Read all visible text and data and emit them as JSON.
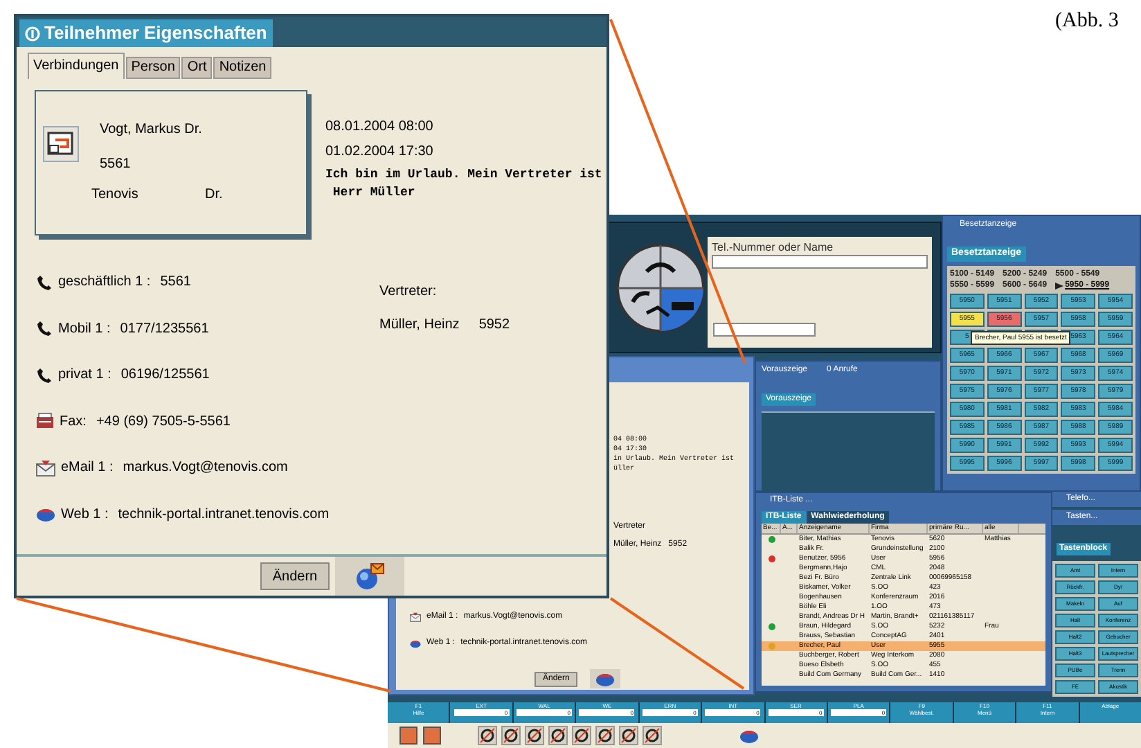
{
  "caption": "(Abb. 3",
  "dialog": {
    "title": "Teilnehmer Eigenschaften",
    "tabs": [
      {
        "label": "Verbindungen",
        "selected": true
      },
      {
        "label": "Person",
        "selected": false
      },
      {
        "label": "Ort",
        "selected": false
      },
      {
        "label": "Notizen",
        "selected": false
      }
    ],
    "card": {
      "name": "Vogt, Markus Dr.",
      "number": "5561",
      "company": "Tenovis",
      "title": "Dr."
    },
    "absence": {
      "from": "08.01.2004 08:00",
      "to": "01.02.2004 17:30",
      "message": [
        "Ich bin im Urlaub. Mein Vertreter ist",
        " Herr Müller"
      ]
    },
    "contacts": [
      {
        "kind": "phone",
        "label": "geschäftlich 1 :",
        "value": "5561"
      },
      {
        "kind": "phone",
        "label": "Mobil 1 :",
        "value": "0177/1235561"
      },
      {
        "kind": "phone",
        "label": "privat 1 :",
        "value": "06196/125561"
      },
      {
        "kind": "fax",
        "label": "Fax:",
        "value": "+49 (69) 7505-5-5561"
      },
      {
        "kind": "email",
        "label": "eMail 1 :",
        "value": "markus.Vogt@tenovis.com"
      },
      {
        "kind": "web",
        "label": "Web 1 :",
        "value": "technik-portal.intranet.tenovis.com"
      }
    ],
    "deputy": {
      "heading": "Vertreter:",
      "name": "Müller, Heinz",
      "number": "5952"
    },
    "button": "Ändern"
  },
  "app": {
    "search": {
      "label": "Tel.-Nummer oder Name"
    },
    "detail_copy": {
      "lines": [
        "04 08:00",
        "04 17:30",
        "in Urlaub. Mein Vertreter ist",
        "üller"
      ],
      "deputy_heading": "Vertreter",
      "deputy": "Müller, Heinz   5952",
      "contacts": [
        {
          "kind": "email",
          "label": "eMail 1 :",
          "value": "markus.Vogt@tenovis.com"
        },
        {
          "kind": "web",
          "label": "Web 1 :",
          "value": "technik-portal.intranet.tenovis.com"
        }
      ],
      "button": "Ändern"
    },
    "busy_panel": {
      "title": "Besetztanzeige",
      "tab": "Besetztanzeige",
      "ranges": [
        {
          "label": "5100 - 5149",
          "selected": false
        },
        {
          "label": "5200 - 5249",
          "selected": false
        },
        {
          "label": "5500 - 5549",
          "selected": false
        },
        {
          "label": "5550 - 5599",
          "selected": false
        },
        {
          "label": "5600 - 5649",
          "selected": false
        },
        {
          "label": "5950 - 5999",
          "selected": true
        }
      ],
      "keys": [
        {
          "label": "5950",
          "color": "#4ea8c0"
        },
        {
          "label": "5951",
          "color": "#4ea8c0"
        },
        {
          "label": "5952",
          "color": "#4ea8c0"
        },
        {
          "label": "5953",
          "color": "#4ea8c0"
        },
        {
          "label": "5954",
          "color": "#4ea8c0"
        },
        {
          "label": "5955",
          "color": "#f4e04a"
        },
        {
          "label": "5956",
          "color": "#e86a6a"
        },
        {
          "label": "5957",
          "color": "#4ea8c0"
        },
        {
          "label": "5958",
          "color": "#4ea8c0"
        },
        {
          "label": "5959",
          "color": "#4ea8c0"
        },
        {
          "label": "5",
          "color": "#4ea8c0",
          "tooltip_anchor": true
        },
        {
          "label": "5963",
          "color": "#4ea8c0"
        },
        {
          "label": "5964",
          "color": "#4ea8c0"
        },
        {
          "label": "5965",
          "color": "#4ea8c0"
        },
        {
          "label": "5966",
          "color": "#4ea8c0"
        },
        {
          "label": "5967",
          "color": "#4ea8c0"
        },
        {
          "label": "5968",
          "color": "#4ea8c0"
        },
        {
          "label": "5969",
          "color": "#4ea8c0"
        },
        {
          "label": "5970",
          "color": "#4ea8c0"
        },
        {
          "label": "5971",
          "color": "#4ea8c0"
        },
        {
          "label": "5972",
          "color": "#4ea8c0"
        },
        {
          "label": "5973",
          "color": "#4ea8c0"
        },
        {
          "label": "5974",
          "color": "#4ea8c0"
        },
        {
          "label": "5975",
          "color": "#4ea8c0"
        },
        {
          "label": "5976",
          "color": "#4ea8c0"
        },
        {
          "label": "5977",
          "color": "#4ea8c0"
        },
        {
          "label": "5978",
          "color": "#4ea8c0"
        },
        {
          "label": "5979",
          "color": "#4ea8c0"
        },
        {
          "label": "5980",
          "color": "#4ea8c0"
        },
        {
          "label": "5981",
          "color": "#4ea8c0"
        },
        {
          "label": "5982",
          "color": "#4ea8c0"
        },
        {
          "label": "5983",
          "color": "#4ea8c0"
        },
        {
          "label": "5984",
          "color": "#4ea8c0"
        },
        {
          "label": "5985",
          "color": "#4ea8c0"
        },
        {
          "label": "5986",
          "color": "#4ea8c0"
        },
        {
          "label": "5987",
          "color": "#4ea8c0"
        },
        {
          "label": "5988",
          "color": "#4ea8c0"
        },
        {
          "label": "5989",
          "color": "#4ea8c0"
        },
        {
          "label": "5990",
          "color": "#4ea8c0"
        },
        {
          "label": "5991",
          "color": "#4ea8c0"
        },
        {
          "label": "5992",
          "color": "#4ea8c0"
        },
        {
          "label": "5993",
          "color": "#4ea8c0"
        },
        {
          "label": "5994",
          "color": "#4ea8c0"
        },
        {
          "label": "5995",
          "color": "#4ea8c0"
        },
        {
          "label": "5996",
          "color": "#4ea8c0"
        },
        {
          "label": "5997",
          "color": "#4ea8c0"
        },
        {
          "label": "5998",
          "color": "#4ea8c0"
        },
        {
          "label": "5999",
          "color": "#4ea8c0"
        }
      ],
      "tooltip": "Brecher, Paul 5955 ist besetzt"
    },
    "preview": {
      "title": "Vorauszeige",
      "count": "0 Anrufe",
      "tab": "Vorauszeige"
    },
    "itb": {
      "title": "ITB-Liste ...",
      "tabs": [
        {
          "label": "ITB-Liste",
          "selected": true
        },
        {
          "label": "Wahlwiederholung",
          "selected": false
        }
      ],
      "columns": [
        "Be...",
        "A...",
        "Anzeigename",
        "Firma",
        "primäre Ru...",
        "alle"
      ],
      "rows": [
        {
          "color": "#1fa03a",
          "cells": [
            "",
            "",
            "Biter, Mathias",
            "Tenovis",
            "5620",
            "Matthias"
          ],
          "selected": false
        },
        {
          "cells": [
            "",
            "",
            "Balik Fr.",
            "Grundeinstellung",
            "2100"
          ],
          "selected": false
        },
        {
          "color": "#d8302a",
          "cells": [
            "",
            "",
            "Benutzer, 5956",
            "User",
            "5956"
          ],
          "selected": false
        },
        {
          "cells": [
            "",
            "",
            "Bergmann,Hajo",
            "CML",
            "2048"
          ],
          "selected": false
        },
        {
          "cells": [
            "",
            "",
            "Bezi Fr. Büro",
            "Zentrale Link",
            "00069965158"
          ],
          "selected": false
        },
        {
          "cells": [
            "",
            "",
            "Biskamer, Volker",
            "S.OO",
            "423"
          ],
          "selected": false
        },
        {
          "cells": [
            "",
            "",
            "Bogenhausen",
            "Konferenzraum",
            "2016"
          ],
          "selected": false
        },
        {
          "cells": [
            "",
            "",
            "Böhle Eli",
            "1.OO",
            "473"
          ],
          "selected": false
        },
        {
          "cells": [
            "",
            "",
            "Brandt, Andreas Dr H",
            "Martin, Brandt+",
            "021161385117"
          ],
          "selected": false
        },
        {
          "color": "#1fa03a",
          "cells": [
            "",
            "",
            "Braun, Hildegard",
            "S.OO",
            "5232",
            "Frau"
          ],
          "selected": false
        },
        {
          "cells": [
            "",
            "",
            "Brauss, Sebastian",
            "ConceptAG",
            "2401"
          ],
          "selected": false
        },
        {
          "color": "#e0a020",
          "cells": [
            "",
            "",
            "Brecher, Paul",
            "User",
            "5955"
          ],
          "selected": true
        },
        {
          "cells": [
            "",
            "",
            "Buchberger, Robert",
            "Weg Interkom",
            "2080"
          ],
          "selected": false
        },
        {
          "cells": [
            "",
            "",
            "Bueso Elsbeth",
            "S.OO",
            "455"
          ],
          "selected": false
        },
        {
          "cells": [
            "",
            "",
            "Build Com Germany",
            "Build Com Ger...",
            "1410"
          ],
          "selected": false
        }
      ]
    },
    "small_windows": [
      {
        "title": "Telefo..."
      },
      {
        "title": "Tasten..."
      }
    ],
    "keypad": {
      "tab": "Tastenblock",
      "keys": [
        "Amt",
        "Intern",
        "Rückfr.",
        "Dy/",
        "Makeln",
        "Auf",
        "Halt",
        "Konferenz",
        "Halt2",
        "Gebucher",
        "Halt3",
        "Lautsprecher",
        "PUBe",
        "Trenn",
        "FE",
        "Akustik"
      ]
    },
    "fkeys": [
      {
        "label": "F1",
        "sub": "Hilfe"
      },
      {
        "label": "EXT",
        "counter": "0"
      },
      {
        "label": "WAL",
        "counter": "0"
      },
      {
        "label": "WE",
        "counter": "0"
      },
      {
        "label": "ERN",
        "counter": "0"
      },
      {
        "label": "INT",
        "counter": "0"
      },
      {
        "label": "SER",
        "counter": "0"
      },
      {
        "label": "PLA",
        "counter": "0"
      },
      {
        "label": "F9",
        "sub": "Wählbest."
      },
      {
        "label": "F10",
        "sub": "Menü"
      },
      {
        "label": "F11",
        "sub": "Intern"
      },
      {
        "label": "Ablage"
      }
    ]
  }
}
